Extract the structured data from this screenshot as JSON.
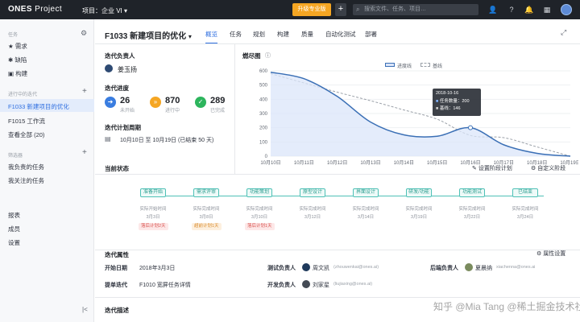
{
  "topbar": {
    "logo": "ONES",
    "logo_sub": "Project",
    "project": "项目：企业 VI",
    "upgrade": "升级专业版",
    "plus": "+",
    "search_placeholder": "搜索文件、任务、项目…"
  },
  "sidebar": {
    "tasks_section": "任务",
    "tasks": [
      "需求",
      "缺陷",
      "构建"
    ],
    "iter_section": "进行中的迭代",
    "iters": [
      "F1033 新建项目的优化",
      "F1015 工作流",
      "查看全部 (20)"
    ],
    "filter_section": "筛选器",
    "filters": [
      "我负责的任务",
      "我关注的任务"
    ],
    "bottom": [
      "报表",
      "成员",
      "设置"
    ],
    "collapse": "|<"
  },
  "header": {
    "title": "F1033 新建项目的优化",
    "tabs": [
      "概览",
      "任务",
      "规划",
      "构建",
      "质量",
      "自动化测试",
      "部署"
    ]
  },
  "left": {
    "owner_label": "迭代负责人",
    "owner_name": "姜玉扬",
    "progress_label": "迭代进度",
    "stats": [
      {
        "value": "26",
        "label": "未开始",
        "color": "#3a7de0"
      },
      {
        "value": "870",
        "label": "进行中",
        "color": "#f5a623"
      },
      {
        "value": "289",
        "label": "已完成",
        "color": "#2db55d"
      }
    ],
    "period_label": "迭代计划周期",
    "period_text": "10月10日 至 10月19日 (已结束 50 天)"
  },
  "burndown": {
    "title": "燃尽图",
    "legend": [
      "进度线",
      "基线"
    ],
    "tooltip_date": "2018-10-16",
    "tooltip_rows": [
      "任务数量：200",
      "基线：146"
    ]
  },
  "chart_data": {
    "type": "area",
    "title": "燃尽图",
    "categories": [
      "10月10日",
      "10月11日",
      "10月12日",
      "10月13日",
      "10月14日",
      "10月15日",
      "10月16日",
      "10月17日",
      "10月18日",
      "10月19日"
    ],
    "series": [
      {
        "name": "进度线",
        "values": [
          590,
          545,
          420,
          240,
          150,
          140,
          200,
          80,
          20,
          0
        ]
      },
      {
        "name": "基线",
        "values": [
          580,
          515,
          450,
          390,
          325,
          260,
          146,
          130,
          65,
          0
        ]
      }
    ],
    "yticks": [
      "0",
      "100",
      "200",
      "300",
      "400",
      "500",
      "600"
    ],
    "ylim": [
      0,
      600
    ],
    "grid": true,
    "legend_position": "top-right"
  },
  "stage": {
    "title": "当前状态",
    "set_plan": "设置阶段计划",
    "custom": "自定义阶段",
    "phases": [
      {
        "name": "准备开始",
        "sub": "实际开始时间",
        "date": "3月3日",
        "tag": "落后计划2天",
        "tagtype": "r"
      },
      {
        "name": "需求评审",
        "sub": "实际完成时间",
        "date": "3月8日",
        "tag": "超前计划1天",
        "tagtype": "o"
      },
      {
        "name": "功能策划",
        "sub": "实际完成时间",
        "date": "3月10日",
        "tag": "落后计划1天",
        "tagtype": "r"
      },
      {
        "name": "原型设计",
        "sub": "实际完成时间",
        "date": "3月12日",
        "tag": "",
        "tagtype": ""
      },
      {
        "name": "界面设计",
        "sub": "实际完成时间",
        "date": "3月14日",
        "tag": "",
        "tagtype": ""
      },
      {
        "name": "研发/功能",
        "sub": "实际完成时间",
        "date": "3月19日",
        "tag": "",
        "tagtype": ""
      },
      {
        "name": "功能测试",
        "sub": "实际完成时间",
        "date": "3月22日",
        "tag": "",
        "tagtype": ""
      },
      {
        "name": "已结束",
        "sub": "实际完成时间",
        "date": "3月24日",
        "tag": "",
        "tagtype": ""
      }
    ]
  },
  "attrs": {
    "title": "迭代属性",
    "settings": "属性设置",
    "start_label": "开始日期",
    "start_value": "2018年3月3日",
    "prev_label": "提单迭代",
    "prev_value": "F1010 宽屏任务详情",
    "test_label": "测试负责人",
    "test_name": "周文凯",
    "test_email": "(zhouwenkai@ones.ai)",
    "dev_label": "开发负责人",
    "dev_name": "刘家星",
    "dev_email": "(liujiaxing@ones.ai)",
    "backend_label": "后端负责人",
    "backend_name": "夏晨纳",
    "backend_email": "xiachenna@ones.ai"
  },
  "desc": {
    "title": "迭代描述"
  },
  "watermark": "知乎 @Mia Tang  @稀土掘金技术社区"
}
